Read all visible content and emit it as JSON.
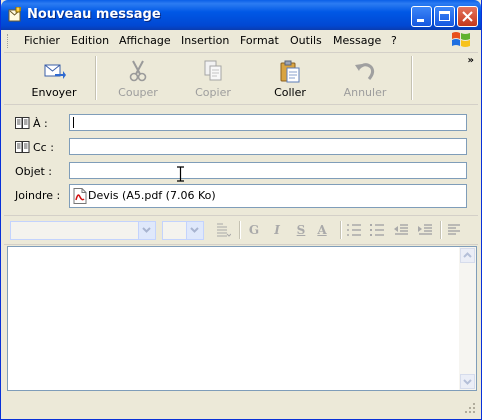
{
  "window": {
    "title": "Nouveau message"
  },
  "menu": [
    "Fichier",
    "Edition",
    "Affichage",
    "Insertion",
    "Format",
    "Outils",
    "Message",
    "?"
  ],
  "toolbar": {
    "send": "Envoyer",
    "cut": "Couper",
    "copy": "Copier",
    "paste": "Coller",
    "undo": "Annuler",
    "more": "»"
  },
  "fields": {
    "to_label": "À :",
    "cc_label": "Cc :",
    "subject_label": "Objet :",
    "attach_label": "Joindre :",
    "to_value": "",
    "cc_value": "",
    "subject_value": "",
    "attachment": "Devis (A5.pdf (7.06 Ko)"
  },
  "format": {
    "font_value": "",
    "size_value": "",
    "bold": "G",
    "italic": "I",
    "underline": "S",
    "color": "A"
  },
  "colors": {
    "titlebar": "#0058e6",
    "window_bg": "#ece9d8",
    "input_border": "#7f9db9"
  }
}
